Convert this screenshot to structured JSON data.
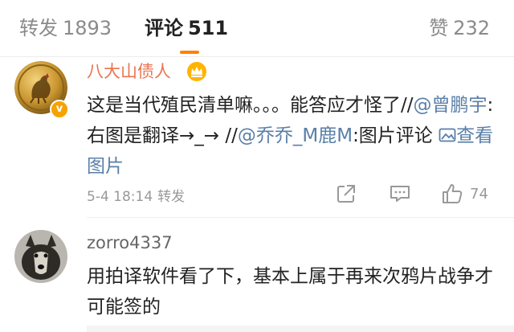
{
  "tabs": {
    "reposts": {
      "label": "转发",
      "count": "1893"
    },
    "comments": {
      "label": "评论",
      "count": "511"
    },
    "likes": {
      "label": "赞",
      "count": "232"
    }
  },
  "comments": [
    {
      "username": "八大山债人",
      "verified_badge": "v",
      "text_part1": "这是当代殖民清单嘛。。。能答应才怪了//",
      "mention1": "@曾鹏宇",
      "text_part2": ":右图是翻译→_→ //",
      "mention2": "@乔乔_M鹿M",
      "text_part3": ":图片评论 ",
      "image_link": "查看图片",
      "time": "5-4 18:14",
      "repost_label": "转发",
      "like_count": "74"
    },
    {
      "username": "zorro4337",
      "text": "用拍译软件看了下，基本上属于再来次鸦片战争才可能签的"
    }
  ],
  "colors": {
    "accent": "#ff8200",
    "mention": "#5a7fa8",
    "username_vip": "#eb7350"
  }
}
